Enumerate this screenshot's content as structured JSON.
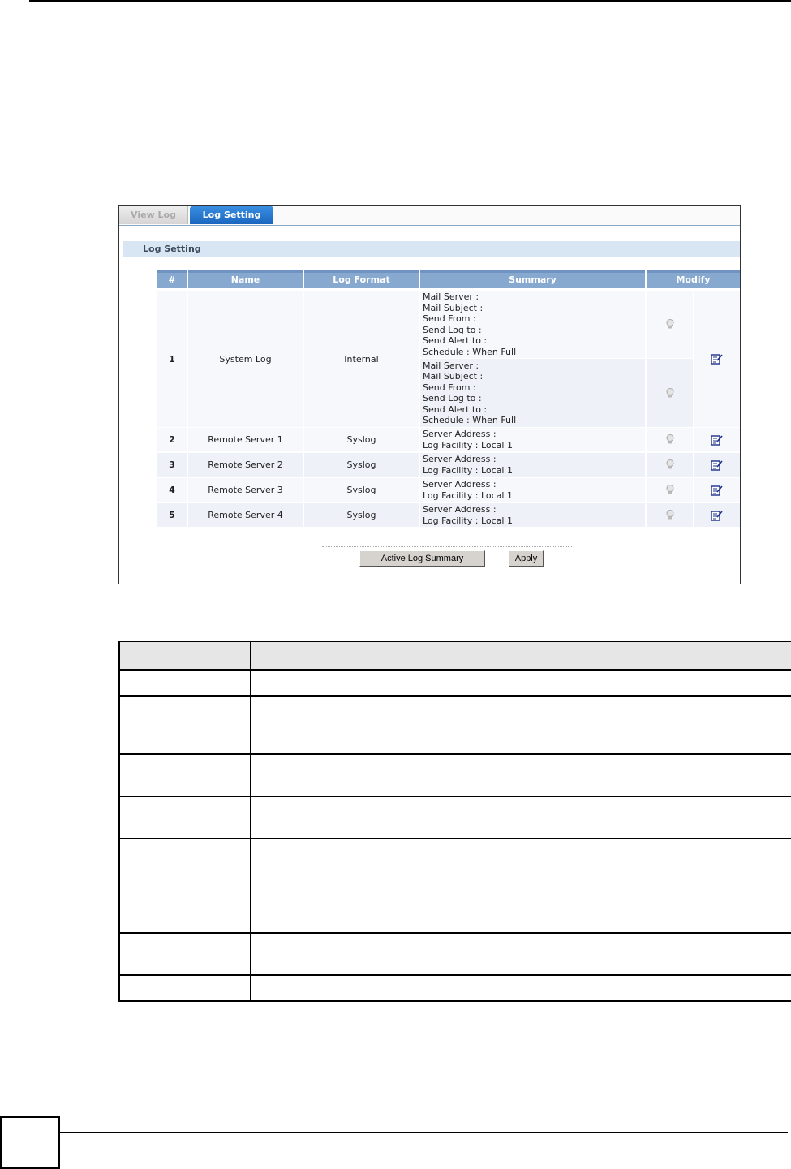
{
  "tabs": [
    {
      "label": "View Log"
    },
    {
      "label": "Log Setting"
    }
  ],
  "section_title": "Log Setting",
  "table": {
    "headers": [
      "#",
      "Name",
      "Log Format",
      "Summary",
      "Modify"
    ],
    "rows": [
      {
        "num": "1",
        "name": "System Log",
        "format": "Internal",
        "summary_a": "Mail Server :\nMail Subject :\nSend From :\nSend Log to :\nSend Alert to :\nSchedule : When Full",
        "summary_b": "Mail Server :\nMail Subject :\nSend From :\nSend Log to :\nSend Alert to :\nSchedule : When Full"
      },
      {
        "num": "2",
        "name": "Remote Server 1",
        "format": "Syslog",
        "summary": "Server Address :\nLog Facility : Local 1"
      },
      {
        "num": "3",
        "name": "Remote Server 2",
        "format": "Syslog",
        "summary": "Server Address :\nLog Facility : Local 1"
      },
      {
        "num": "4",
        "name": "Remote Server 3",
        "format": "Syslog",
        "summary": "Server Address :\nLog Facility : Local 1"
      },
      {
        "num": "5",
        "name": "Remote Server 4",
        "format": "Syslog",
        "summary": "Server Address :\nLog Facility : Local 1"
      }
    ]
  },
  "buttons": {
    "active_log_summary": "Active Log Summary",
    "apply": "Apply"
  },
  "icons": {
    "active": "lightbulb-icon",
    "modify": "edit-icon"
  },
  "colors": {
    "tab_active": "#1a66bf",
    "header": "#87a8cf",
    "section": "#d8e6f3",
    "row_alt": "#eef1f8"
  }
}
